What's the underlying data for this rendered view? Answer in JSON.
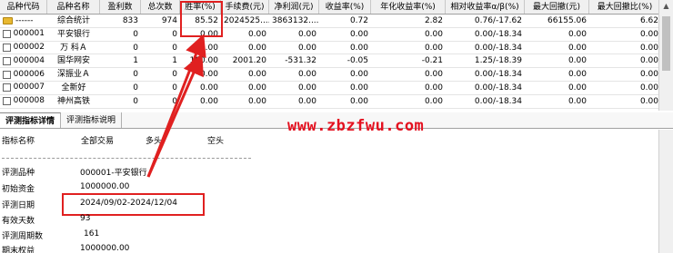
{
  "table": {
    "headers": [
      "品种代码",
      "品种名称",
      "盈利数",
      "总次数",
      "胜率(%)",
      "手续费(元)",
      "净利润(元)",
      "收益率(%)",
      "年化收益率(%)",
      "相对收益率α/β(%)",
      "最大回撤(元)",
      "最大回撤比(%)"
    ],
    "rows": [
      {
        "code": "------",
        "name": "综合统计",
        "win": "833",
        "total": "974",
        "rate": "85.52",
        "fee": "2024525....",
        "profit": "3863132....",
        "ret": "0.72",
        "annual": "2.82",
        "rel": "0.76/-17.62",
        "maxdd": "66155.06",
        "ddratio": "6.62",
        "icon": "folder"
      },
      {
        "code": "000001",
        "name": "平安银行",
        "win": "0",
        "total": "0",
        "rate": "0.00",
        "fee": "0.00",
        "profit": "0.00",
        "ret": "0.00",
        "annual": "0.00",
        "rel": "0.00/-18.34",
        "maxdd": "0.00",
        "ddratio": "0.00",
        "icon": "checkbox"
      },
      {
        "code": "000002",
        "name": "万 科Ａ",
        "win": "0",
        "total": "0",
        "rate": "0.00",
        "fee": "0.00",
        "profit": "0.00",
        "ret": "0.00",
        "annual": "0.00",
        "rel": "0.00/-18.34",
        "maxdd": "0.00",
        "ddratio": "0.00",
        "icon": "checkbox"
      },
      {
        "code": "000004",
        "name": "国华网安",
        "win": "1",
        "total": "1",
        "rate": "100.00",
        "fee": "2001.20",
        "profit": "-531.32",
        "ret": "-0.05",
        "annual": "-0.21",
        "rel": "1.25/-18.39",
        "maxdd": "0.00",
        "ddratio": "0.00",
        "icon": "checkbox"
      },
      {
        "code": "000006",
        "name": "深振业Ａ",
        "win": "0",
        "total": "0",
        "rate": "0.00",
        "fee": "0.00",
        "profit": "0.00",
        "ret": "0.00",
        "annual": "0.00",
        "rel": "0.00/-18.34",
        "maxdd": "0.00",
        "ddratio": "0.00",
        "icon": "checkbox"
      },
      {
        "code": "000007",
        "name": "全新好",
        "win": "0",
        "total": "0",
        "rate": "0.00",
        "fee": "0.00",
        "profit": "0.00",
        "ret": "0.00",
        "annual": "0.00",
        "rel": "0.00/-18.34",
        "maxdd": "0.00",
        "ddratio": "0.00",
        "icon": "checkbox"
      },
      {
        "code": "000008",
        "name": "神州高铁",
        "win": "0",
        "total": "0",
        "rate": "0.00",
        "fee": "0.00",
        "profit": "0.00",
        "ret": "0.00",
        "annual": "0.00",
        "rel": "0.00/-18.34",
        "maxdd": "0.00",
        "ddratio": "0.00",
        "icon": "checkbox"
      }
    ]
  },
  "tabs": [
    "评测指标详情",
    "评测指标说明"
  ],
  "watermark": "www.zbzfwu.com",
  "detail": {
    "headers": {
      "name": "指标名称",
      "all": "全部交易",
      "long": "多头",
      "short": "空头"
    },
    "rows": [
      {
        "label": "评测品种",
        "value": "000001-平安银行"
      },
      {
        "label": "初始资金",
        "value": "1000000.00"
      },
      {
        "label": "评测日期",
        "value": "2024/09/02-2024/12/04"
      },
      {
        "label": "有效天数",
        "value": "93"
      },
      {
        "label": "评测周期数",
        "value": "161"
      },
      {
        "label": "期末权益",
        "value": "1000000.00"
      }
    ]
  },
  "colors": {
    "annotation": "#e02020",
    "watermark": "#e4101f",
    "folder": "#e8b830"
  }
}
